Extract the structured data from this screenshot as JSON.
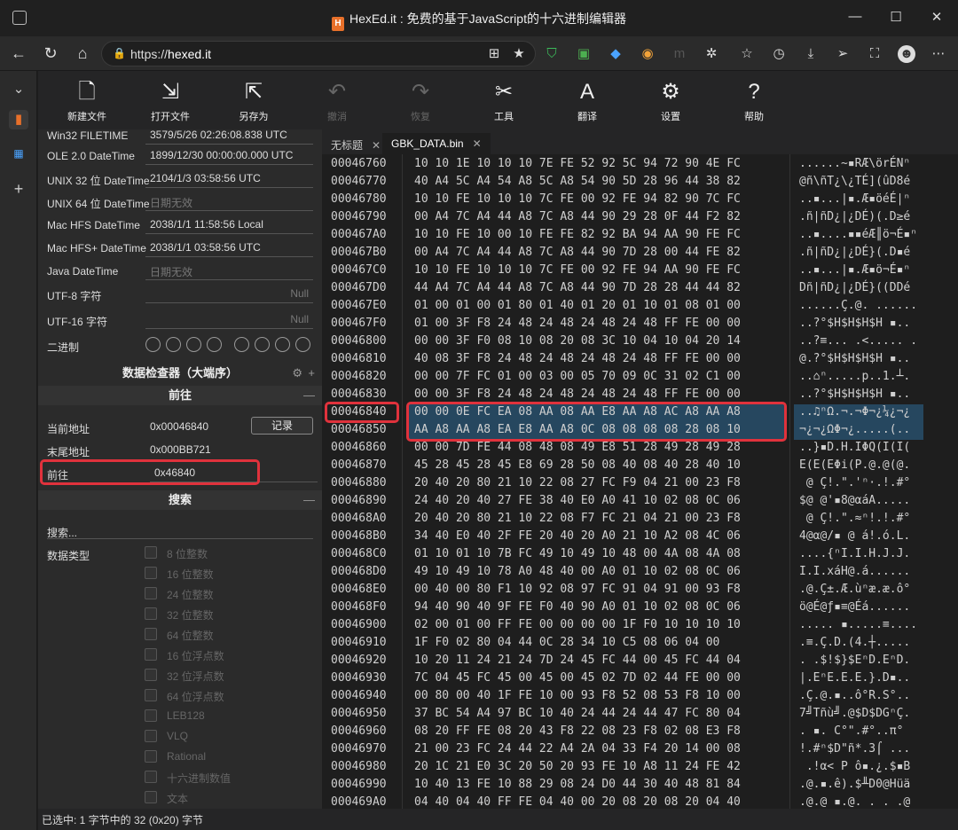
{
  "window": {
    "title": "HexEd.it : 免费的基于JavaScript的十六进制编辑器",
    "favicon": "H"
  },
  "browser": {
    "url_prefix": "https://",
    "url_host": "hexed.it"
  },
  "toolbar": {
    "items": [
      {
        "label": "新建文件",
        "icon": "new-file-icon",
        "glyph": "🗋"
      },
      {
        "label": "打开文件",
        "icon": "open-file-icon",
        "glyph": "⇲"
      },
      {
        "label": "另存为",
        "icon": "save-as-icon",
        "glyph": "⇱"
      },
      {
        "label": "撤消",
        "icon": "undo-icon",
        "glyph": "↶"
      },
      {
        "label": "恢复",
        "icon": "redo-icon",
        "glyph": "↷"
      },
      {
        "label": "工具",
        "icon": "tools-icon",
        "glyph": "✂"
      },
      {
        "label": "翻译",
        "icon": "translate-icon",
        "glyph": "A"
      },
      {
        "label": "设置",
        "icon": "settings-icon",
        "glyph": "⚙"
      },
      {
        "label": "帮助",
        "icon": "help-icon",
        "glyph": "?"
      }
    ]
  },
  "inspector": {
    "rows": [
      {
        "key": "Win32 FILETIME",
        "value": "3579/5/26 02:26:08.838 UTC",
        "placeholder": false
      },
      {
        "key": "OLE 2.0 DateTime",
        "value": "1899/12/30 00:00:00.000 UTC",
        "placeholder": false
      },
      {
        "key": "UNIX 32 位 DateTime",
        "value": "2104/1/3 03:58:56 UTC",
        "placeholder": false
      },
      {
        "key": "UNIX 64 位 DateTime",
        "value": "日期无效",
        "placeholder": true
      },
      {
        "key": "Mac HFS DateTime",
        "value": "2038/1/1 11:58:56 Local",
        "placeholder": false
      },
      {
        "key": "Mac HFS+ DateTime",
        "value": "2038/1/1 03:58:56 UTC",
        "placeholder": false
      },
      {
        "key": "Java DateTime",
        "value": "日期无效",
        "placeholder": true
      }
    ],
    "utf8_label": "UTF-8 字符",
    "utf8_value": "Null",
    "utf16_label": "UTF-16 字符",
    "utf16_value": "Null",
    "binary_label": "二进制",
    "header": "数据检查器（大端序）"
  },
  "goto": {
    "header": "前往",
    "current_label": "当前地址",
    "current_value": "0x00046840",
    "record_button": "记录",
    "end_label": "末尾地址",
    "end_value": "0x000BB721",
    "goto_label": "前往",
    "goto_value": "0x46840"
  },
  "search": {
    "header": "搜索",
    "search_label": "搜索...",
    "datatype_label": "数据类型",
    "types": [
      "8 位整数",
      "16 位整数",
      "24 位整数",
      "32 位整数",
      "64 位整数",
      "16 位浮点数",
      "32 位浮点数",
      "64 位浮点数",
      "LEB128",
      "VLQ",
      "Rational",
      "十六进制数值",
      "文本"
    ]
  },
  "tabs": [
    {
      "label": "无标题",
      "active": false
    },
    {
      "label": "GBK_DATA.bin",
      "active": true
    }
  ],
  "hex_rows": [
    {
      "addr": "00046760",
      "hex": "10 10 1E 10 10 10 7E FE 52 92 5C 94 72 90 4E FC",
      "text": "......~▪RÆ\\örÉNⁿ"
    },
    {
      "addr": "00046770",
      "hex": "40 A4 5C A4 54 A8 5C A8 54 90 5D 28 96 44 38 82",
      "text": "@ñ\\ñT¿\\¿TÉ](ûD8é"
    },
    {
      "addr": "00046780",
      "hex": "10 10 FE 10 10 10 7C FE 00 92 FE 94 82 90 7C FC",
      "text": "..▪...|▪.Æ▪öéÉ|ⁿ"
    },
    {
      "addr": "00046790",
      "hex": "00 A4 7C A4 44 A8 7C A8 44 90 29 28 0F 44 F2 82",
      "text": ".ñ|ñD¿|¿DÉ)(.D≥é"
    },
    {
      "addr": "000467A0",
      "hex": "10 10 FE 10 00 10 FE FE 82 92 BA 94 AA 90 FE FC",
      "text": "..▪....▪▪éÆ║ö¬É▪ⁿ"
    },
    {
      "addr": "000467B0",
      "hex": "00 A4 7C A4 44 A8 7C A8 44 90 7D 28 00 44 FE 82",
      "text": ".ñ|ñD¿|¿DÉ}(.D▪é"
    },
    {
      "addr": "000467C0",
      "hex": "10 10 FE 10 10 10 7C FE 00 92 FE 94 AA 90 FE FC",
      "text": "..▪...|▪.Æ▪ö¬É▪ⁿ"
    },
    {
      "addr": "000467D0",
      "hex": "44 A4 7C A4 44 A8 7C A8 44 90 7D 28 28 44 44 82",
      "text": "Dñ|ñD¿|¿DÉ}((DDé"
    },
    {
      "addr": "000467E0",
      "hex": "01 00 01 00 01 80 01 40 01 20 01 10 01 08 01 00",
      "text": "......Ç.@. ......"
    },
    {
      "addr": "000467F0",
      "hex": "01 00 3F F8 24 48 24 48 24 48 24 48 FF FE 00 00",
      "text": "..?°$H$H$H$H ▪.."
    },
    {
      "addr": "00046800",
      "hex": "00 00 3F F0 08 10 08 20 08 3C 10 04 10 04 20 14",
      "text": "..?≡... .<..... ."
    },
    {
      "addr": "00046810",
      "hex": "40 08 3F F8 24 48 24 48 24 48 24 48 FF FE 00 00",
      "text": "@.?°$H$H$H$H ▪.."
    },
    {
      "addr": "00046820",
      "hex": "00 00 7F FC 01 00 03 00 05 70 09 0C 31 02 C1 00",
      "text": "..⌂ⁿ.....p..1.┴."
    },
    {
      "addr": "00046830",
      "hex": "00 00 3F F8 24 48 24 48 24 48 24 48 FF FE 00 00",
      "text": "..?°$H$H$H$H ▪.."
    },
    {
      "addr": "00046840",
      "hex": "00 00 0E FC EA 08 AA 08 AA E8 AA A8 AC A8 AA A8",
      "text": "..♫ⁿΩ.¬.¬Φ¬¿¼¿¬¿"
    },
    {
      "addr": "00046850",
      "hex": "AA A8 AA A8 EA E8 AA A8 0C 08 08 08 08 28 08 10",
      "text": "¬¿¬¿ΩΦ¬¿.....(.."
    },
    {
      "addr": "00046860",
      "hex": "00 00 7D FE 44 08 48 08 49 E8 51 28 49 28 49 28",
      "text": "..}▪D.H.IΦQ(I(I("
    },
    {
      "addr": "00046870",
      "hex": "45 28 45 28 45 E8 69 28 50 08 40 08 40 28 40 10",
      "text": "E(E(EΦi(P.@.@(@."
    },
    {
      "addr": "00046880",
      "hex": "20 40 20 80 21 10 22 08 27 FC F9 04 21 00 23 F8",
      "text": " @ Ç!.\".'ⁿ·.!.#°"
    },
    {
      "addr": "00046890",
      "hex": "24 40 20 40 27 FE 38 40 E0 A0 41 10 02 08 0C 06",
      "text": "$@ @'▪8@αáA....."
    },
    {
      "addr": "000468A0",
      "hex": "20 40 20 80 21 10 22 08 F7 FC 21 04 21 00 23 F8",
      "text": " @ Ç!.\".≈ⁿ!.!.#°"
    },
    {
      "addr": "000468B0",
      "hex": "34 40 E0 40 2F FE 20 40 20 A0 21 10 A2 08 4C 06",
      "text": "4@α@/▪ @ á!.ó.L."
    },
    {
      "addr": "000468C0",
      "hex": "01 10 01 10 7B FC 49 10 49 10 48 00 4A 08 4A 08",
      "text": "....{ⁿI.I.H.J.J."
    },
    {
      "addr": "000468D0",
      "hex": "49 10 49 10 78 A0 48 40 00 A0 01 10 02 08 0C 06",
      "text": "I.I.xáH@.á......"
    },
    {
      "addr": "000468E0",
      "hex": "00 40 00 80 F1 10 92 08 97 FC 91 04 91 00 93 F8",
      "text": ".@.Ç±.Æ.ùⁿæ.æ.ô°"
    },
    {
      "addr": "000468F0",
      "hex": "94 40 90 40 9F FE F0 40 90 A0 01 10 02 08 0C 06",
      "text": "ö@É@ƒ▪≡@Éá......"
    },
    {
      "addr": "00046900",
      "hex": "02 00 01 00 FF FE 00 00 00 00 1F F0 10 10 10 10",
      "text": "..... ▪.....≡...."
    },
    {
      "addr": "00046910",
      "hex": "1F F0 02 80 04 44 0C 28 34 10 C5 08 06 04 00",
      "text": ".≡.Ç.D.(4.┼....."
    },
    {
      "addr": "00046920",
      "hex": "10 20 11 24 21 24 7D 24 45 FC 44 00 45 FC 44 04",
      "text": ". .$!$}$EⁿD.EⁿD."
    },
    {
      "addr": "00046930",
      "hex": "7C 04 45 FC 45 00 45 00 45 02 7D 02 44 FE 00 00",
      "text": "|.EⁿE.E.E.}.D▪.."
    },
    {
      "addr": "00046940",
      "hex": "00 80 00 40 1F FE 10 00 93 F8 52 08 53 F8 10 00",
      "text": ".Ç.@.▪..ô°R.S°.."
    },
    {
      "addr": "00046950",
      "hex": "37 BC 54 A4 97 BC 10 40 24 44 24 44 47 FC 80 04",
      "text": "7╝Tñù╝.@$D$DGⁿÇ."
    },
    {
      "addr": "00046960",
      "hex": "08 20 FF FE 08 20 43 F8 22 08 23 F8 02 08 E3 F8",
      "text": ". ▪. C°\".#°..π°"
    },
    {
      "addr": "00046970",
      "hex": "21 00 23 FC 24 44 22 A4 2A 04 33 F4 20 14 00 08",
      "text": "!.#ⁿ$D\"ñ*.3⌠ ..."
    },
    {
      "addr": "00046980",
      "hex": "20 1C 21 E0 3C 20 50 20 93 FE 10 A8 11 24 FE 42",
      "text": " .!α< P ô▪.¿.$▪B"
    },
    {
      "addr": "00046990",
      "hex": "10 40 13 FE 10 88 29 08 24 D0 44 30 40 48 81 84",
      "text": ".@.▪.ê).$╨D0@Hüä"
    },
    {
      "addr": "000469A0",
      "hex": "04 40 04 40 FF FE 04 40 00 20 08 20 08 20 04 40",
      "text": ".@.@ ▪.@. . . .@"
    }
  ],
  "status": {
    "text": "已选中: 1 字节中的 32 (0x20) 字节"
  },
  "colors": {
    "accent_red": "#e0323c",
    "selection": "#26475f"
  }
}
